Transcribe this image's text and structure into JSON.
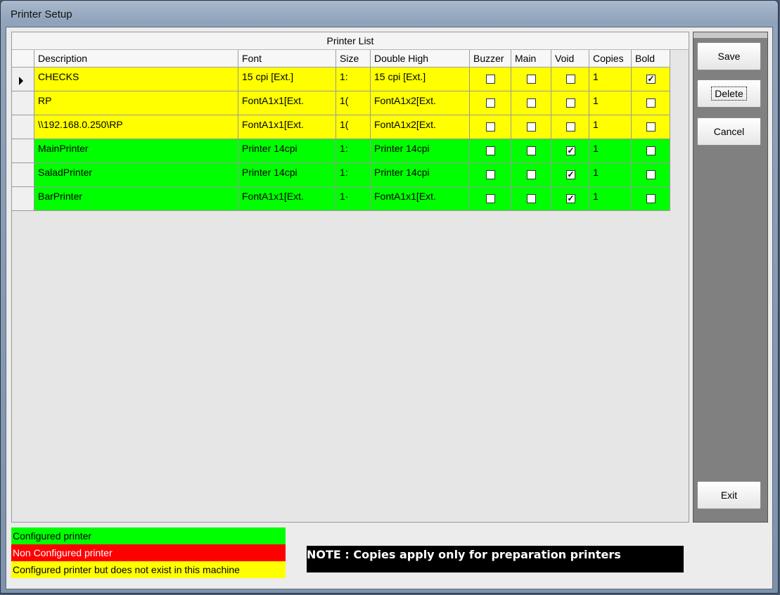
{
  "window": {
    "title": "Printer Setup"
  },
  "grid": {
    "caption": "Printer List",
    "columns": [
      "Description",
      "Font",
      "Size",
      "Double High",
      "Buzzer",
      "Main",
      "Void",
      "Copies",
      "Bold"
    ],
    "rows": [
      {
        "description": "CHECKS",
        "font": "15 cpi [Ext.]",
        "size": "1:",
        "double_high": "15 cpi [Ext.]",
        "buzzer": false,
        "main": false,
        "void": false,
        "copies": "1",
        "bold": true,
        "status": "Configured printer but does not exist in this machine",
        "selected": true
      },
      {
        "description": "RP",
        "font": "FontA1x1[Ext.",
        "size": "1(",
        "double_high": "FontA1x2[Ext.",
        "buzzer": false,
        "main": false,
        "void": false,
        "copies": "1",
        "bold": false,
        "status": "Configured printer but does not exist in this machine",
        "selected": false
      },
      {
        "description": "\\\\192.168.0.250\\RP",
        "font": "FontA1x1[Ext.",
        "size": "1(",
        "double_high": "FontA1x2[Ext.",
        "buzzer": false,
        "main": false,
        "void": false,
        "copies": "1",
        "bold": false,
        "status": "Configured printer but does not exist in this machine",
        "selected": false
      },
      {
        "description": "MainPrinter",
        "font": "Printer 14cpi",
        "size": "1:",
        "double_high": "Printer 14cpi",
        "buzzer": false,
        "main": false,
        "void": true,
        "copies": "1",
        "bold": false,
        "status": "Configured printer",
        "selected": false
      },
      {
        "description": "SaladPrinter",
        "font": "Printer 14cpi",
        "size": "1:",
        "double_high": "Printer 14cpi",
        "buzzer": false,
        "main": false,
        "void": true,
        "copies": "1",
        "bold": false,
        "status": "Configured printer",
        "selected": false
      },
      {
        "description": "BarPrinter",
        "font": "FontA1x1[Ext.",
        "size": "1·",
        "double_high": "FontA1x1[Ext.",
        "buzzer": false,
        "main": false,
        "void": true,
        "copies": "1",
        "bold": false,
        "status": "Configured printer",
        "selected": false
      }
    ]
  },
  "buttons": {
    "save": "Save",
    "delete": "Delete",
    "cancel": "Cancel",
    "exit": "Exit"
  },
  "legend": [
    {
      "label": "Configured printer",
      "color": "#00ff00",
      "text_color": "#000000"
    },
    {
      "label": "Non Configured printer",
      "color": "#ff0000",
      "text_color": "#ffffff"
    },
    {
      "label": "Configured printer but does not exist in this machine",
      "color": "#ffff00",
      "text_color": "#000000"
    }
  ],
  "note": "NOTE : Copies apply only for preparation printers",
  "colors": {
    "configured": "#00ff00",
    "non_configured": "#ff0000",
    "missing": "#ffff00"
  }
}
